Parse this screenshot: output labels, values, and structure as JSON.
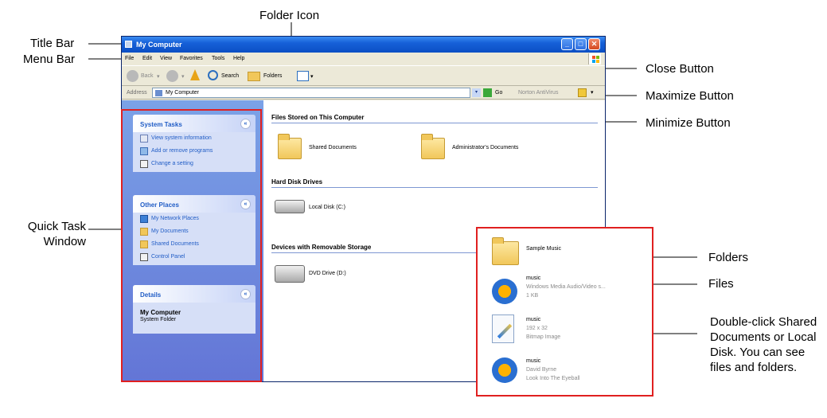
{
  "callouts": {
    "title_bar": "Title Bar",
    "menu_bar": "Menu Bar",
    "folder_icon": "Folder Icon",
    "close_button": "Close Button",
    "maximize_button": "Maximize Button",
    "minimize_button": "Minimize Button",
    "quick_task_window": "Quick Task Window",
    "folders": "Folders",
    "files": "Files",
    "double_click": "Double-click Shared Documents or Local Disk. You can see files and folders."
  },
  "window": {
    "title": "My Computer",
    "menu": [
      "File",
      "Edit",
      "View",
      "Favorites",
      "Tools",
      "Help"
    ],
    "toolbar": {
      "back": "Back",
      "search": "Search",
      "folders": "Folders"
    },
    "address": {
      "label": "Address",
      "value": "My Computer",
      "go": "Go",
      "norton": "Norton AntiVirus"
    }
  },
  "taskpane": {
    "system_tasks": {
      "title": "System Tasks",
      "links": [
        "View system information",
        "Add or remove programs",
        "Change a setting"
      ]
    },
    "other_places": {
      "title": "Other Places",
      "links": [
        "My Network Places",
        "My Documents",
        "Shared Documents",
        "Control Panel"
      ]
    },
    "details": {
      "title": "Details",
      "name": "My Computer",
      "sub": "System Folder"
    }
  },
  "content": {
    "groups": [
      {
        "title": "Files Stored on This Computer",
        "items": [
          "Shared Documents",
          "Administrator's Documents"
        ]
      },
      {
        "title": "Hard Disk Drives",
        "items": [
          "Local Disk (C:)"
        ]
      },
      {
        "title": "Devices with Removable Storage",
        "items": [
          "DVD Drive (D:)"
        ]
      }
    ]
  },
  "zoom": {
    "items": [
      {
        "name": "Sample Music",
        "sub1": "",
        "sub2": ""
      },
      {
        "name": "music",
        "sub1": "Windows Media Audio/Video s...",
        "sub2": "1 KB"
      },
      {
        "name": "music",
        "sub1": "192 x 32",
        "sub2": "Bitmap Image"
      },
      {
        "name": "music",
        "sub1": "David Byrne",
        "sub2": "Look Into The Eyeball"
      }
    ]
  },
  "colors": {
    "callout_line": "#000000",
    "highlight_box": "#e02020",
    "xp_blue": "#0b4fc4"
  }
}
